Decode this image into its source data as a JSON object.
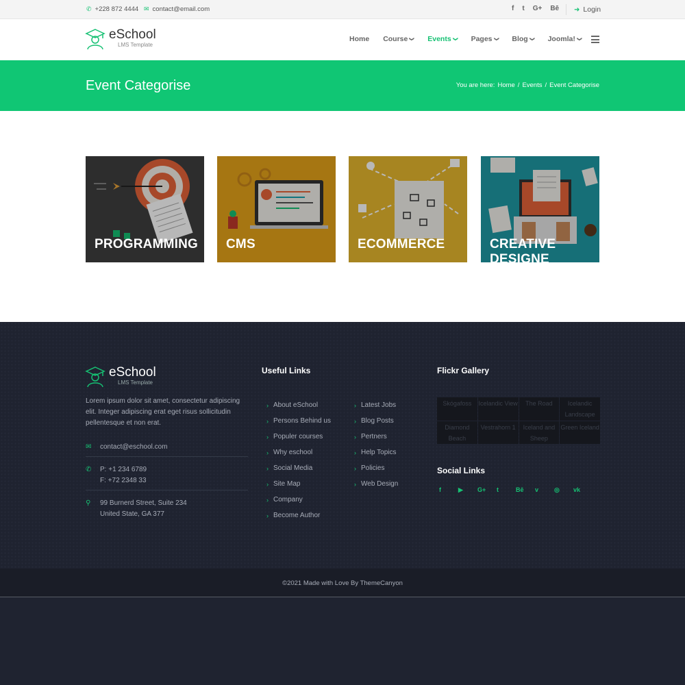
{
  "topbar": {
    "phone": "+228 872 4444",
    "email": "contact@email.com",
    "socials": [
      "f",
      "t",
      "G+",
      "Bē"
    ],
    "login": "Login"
  },
  "brand": {
    "name": "eSchool",
    "tagline": "LMS Template"
  },
  "nav": {
    "items": [
      {
        "label": "Home",
        "dropdown": false
      },
      {
        "label": "Course",
        "dropdown": true
      },
      {
        "label": "Events",
        "dropdown": true,
        "active": true
      },
      {
        "label": "Pages",
        "dropdown": true
      },
      {
        "label": "Blog",
        "dropdown": true
      },
      {
        "label": "Joomla!",
        "dropdown": true
      }
    ]
  },
  "page": {
    "title": "Event Categorise",
    "breadcrumb": {
      "prefix": "You are here:",
      "items": [
        "Home",
        "Events",
        "Event Categorise"
      ]
    }
  },
  "categories": [
    {
      "label": "PROGRAMMING",
      "bg": "#3f3f3f"
    },
    {
      "label": "CMS",
      "bg": "#e7a419"
    },
    {
      "label": "ECOMMERCE",
      "bg": "#e8b92f"
    },
    {
      "label": "CREATIVE DESIGNE",
      "bg": "#1f9aa6"
    }
  ],
  "footer": {
    "about": "Lorem ipsum dolor sit amet, consectetur adipiscing elit. Integer adipiscing erat eget risus sollicitudin pellentesque et non erat.",
    "email": "contact@eschool.com",
    "phone1": "P: +1 234 6789",
    "phone2": "F: +72 2348 33",
    "address1": "99 Burnerd Street, Suite 234",
    "address2": "United State, GA 377",
    "useful_links_title": "Useful Links",
    "links_col1": [
      "About eSchool",
      "Persons Behind us",
      "Populer courses",
      "Why eschool",
      "Social Media",
      "Site Map",
      "Company",
      "Become Author"
    ],
    "links_col2": [
      "Latest Jobs",
      "Blog Posts",
      "Pertners",
      "Help Topics",
      "Policies",
      "Web Design"
    ],
    "flickr_title": "Flickr Gallery",
    "flickr": [
      "Skógafoss",
      "Icelandic View",
      "The Road",
      "Icelandic Landscape",
      "Diamond Beach",
      "Vestrahorn 1",
      "Iceland and Sheep",
      "Green Iceland"
    ],
    "social_title": "Social Links",
    "social_icons": [
      "f",
      "▶",
      "G+",
      "t",
      "Bē",
      "v",
      "◎",
      "vk"
    ],
    "copyright": "©2021 Made with Love By ThemeCanyon"
  },
  "colors": {
    "accent": "#10c674",
    "footer_bg": "#1f2330"
  }
}
